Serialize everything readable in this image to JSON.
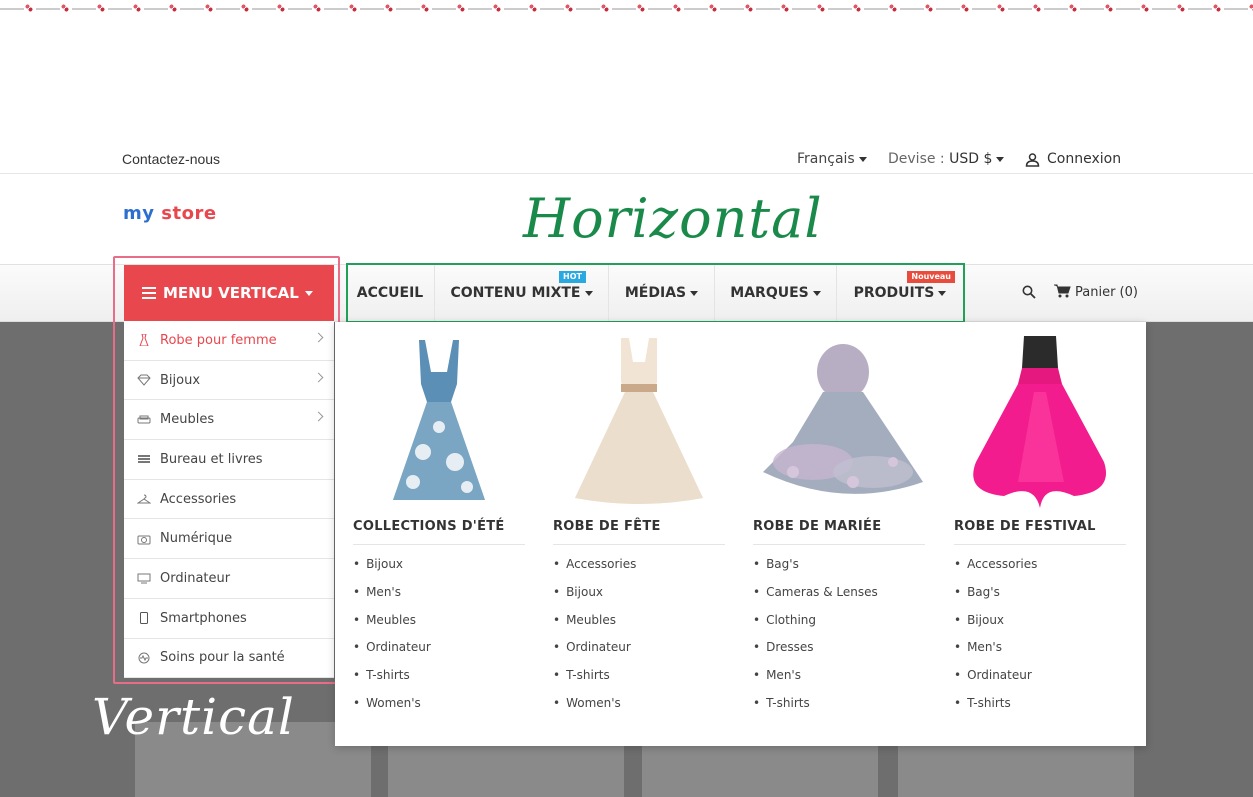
{
  "topbar": {
    "contact": "Contactez-nous",
    "language": "Français",
    "currency_label": "Devise :",
    "currency_value": "USD $",
    "login": "Connexion"
  },
  "logo": {
    "parts": [
      "my",
      "store"
    ]
  },
  "labels": {
    "horizontal": "Horizontal",
    "vertical": "Vertical"
  },
  "vertical_menu": {
    "title": "MENU VERTICAL",
    "items": [
      {
        "label": "Robe pour femme",
        "icon": "dress-icon",
        "has_sub": true
      },
      {
        "label": "Bijoux",
        "icon": "diamond-icon",
        "has_sub": true
      },
      {
        "label": "Meubles",
        "icon": "sofa-icon",
        "has_sub": true
      },
      {
        "label": "Bureau et livres",
        "icon": "books-icon",
        "has_sub": false
      },
      {
        "label": "Accessories",
        "icon": "hanger-icon",
        "has_sub": false
      },
      {
        "label": "Numérique",
        "icon": "camera-icon",
        "has_sub": false
      },
      {
        "label": "Ordinateur",
        "icon": "monitor-icon",
        "has_sub": false
      },
      {
        "label": "Smartphones",
        "icon": "phone-icon",
        "has_sub": false
      },
      {
        "label": "Soins pour la santé",
        "icon": "health-icon",
        "has_sub": false
      }
    ]
  },
  "horizontal_menu": {
    "items": [
      {
        "label": "ACCUEIL"
      },
      {
        "label": "CONTENU MIXTE",
        "badge": "HOT"
      },
      {
        "label": "MÉDIAS"
      },
      {
        "label": "MARQUES"
      },
      {
        "label": "PRODUITS",
        "badge": "Nouveau"
      }
    ]
  },
  "cart": {
    "label": "Panier (0)"
  },
  "mega_menu": {
    "columns": [
      {
        "title": "COLLECTIONS D'ÉTÉ",
        "links": [
          "Bijoux",
          "Men's",
          "Meubles",
          "Ordinateur",
          "T-shirts",
          "Women's"
        ]
      },
      {
        "title": "ROBE DE FÊTE",
        "links": [
          "Accessories",
          "Bijoux",
          "Meubles",
          "Ordinateur",
          "T-shirts",
          "Women's"
        ]
      },
      {
        "title": "ROBE DE MARIÉE",
        "links": [
          "Bag's",
          "Cameras & Lenses",
          "Clothing",
          "Dresses",
          "Men's",
          "T-shirts"
        ]
      },
      {
        "title": "ROBE DE FESTIVAL",
        "links": [
          "Accessories",
          "Bag's",
          "Bijoux",
          "Men's",
          "Ordinateur",
          "T-shirts"
        ]
      }
    ]
  },
  "colors": {
    "accent": "#e8474e",
    "horizontal_label": "#1a8a4b",
    "frame_vertical": "#e76d88",
    "frame_horizontal": "#21a05a",
    "badge_hot": "#29a9e0",
    "badge_new": "#e74c3c"
  }
}
